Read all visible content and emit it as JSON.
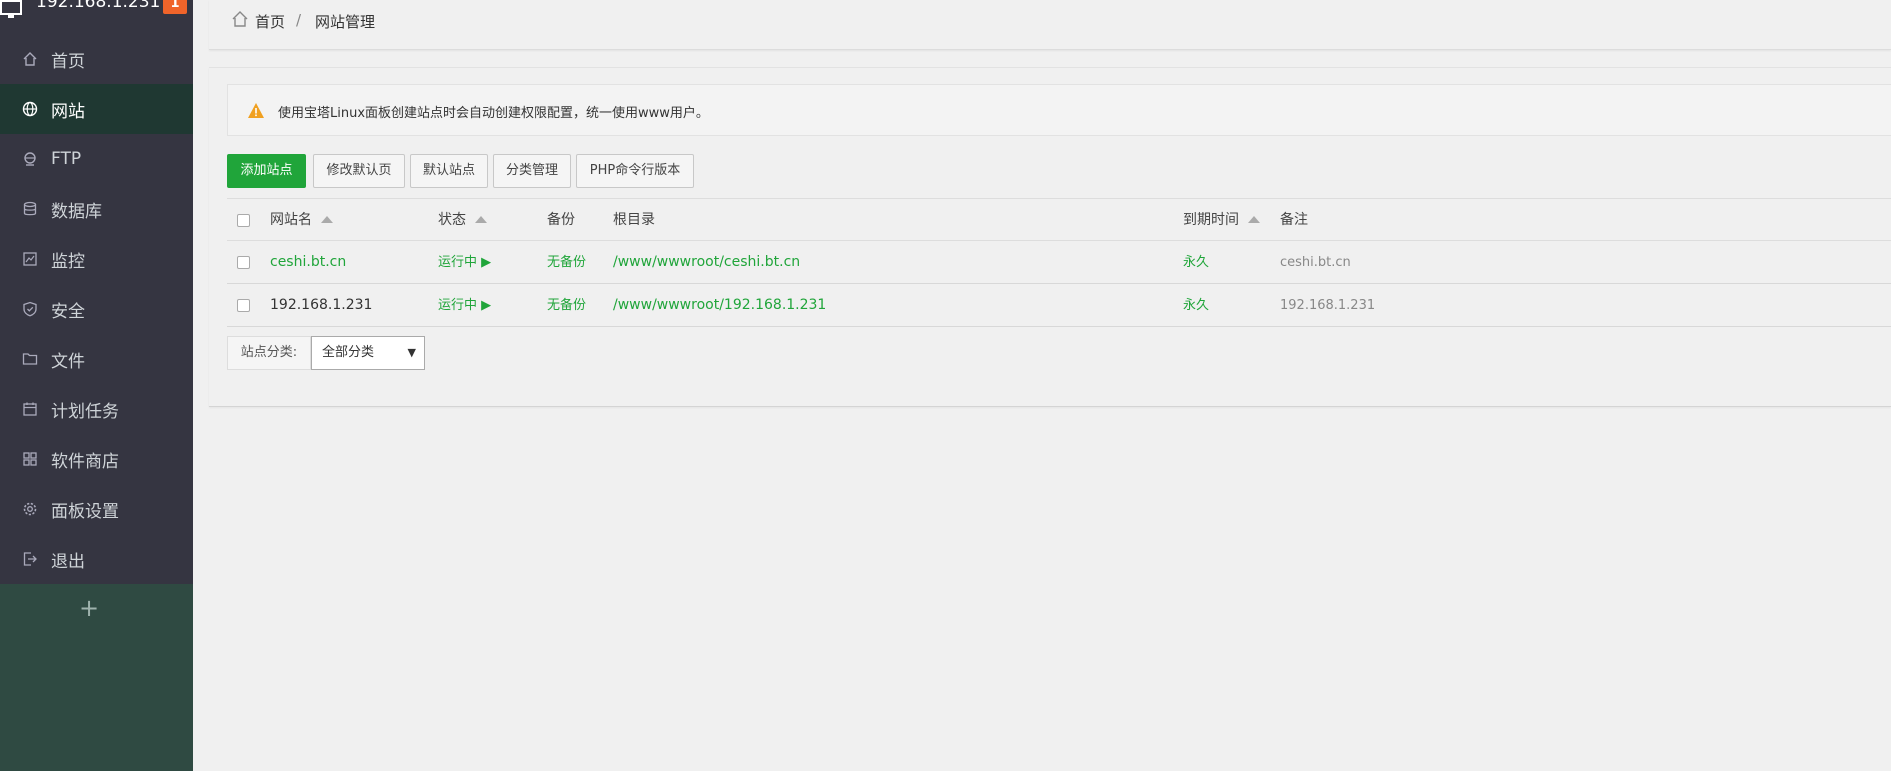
{
  "sidebar": {
    "ip": "192.168.1.231",
    "badge": "1",
    "items": [
      {
        "label": "首页",
        "icon": "home-icon"
      },
      {
        "label": "网站",
        "icon": "globe-icon",
        "active": true
      },
      {
        "label": "FTP",
        "icon": "ftp-icon"
      },
      {
        "label": "数据库",
        "icon": "database-icon"
      },
      {
        "label": "监控",
        "icon": "monitor-icon"
      },
      {
        "label": "安全",
        "icon": "shield-icon"
      },
      {
        "label": "文件",
        "icon": "folder-icon"
      },
      {
        "label": "计划任务",
        "icon": "calendar-icon"
      },
      {
        "label": "软件商店",
        "icon": "grid-icon"
      },
      {
        "label": "面板设置",
        "icon": "gear-icon"
      },
      {
        "label": "退出",
        "icon": "logout-icon"
      }
    ],
    "add": "+"
  },
  "breadcrumb": {
    "home": "首页",
    "sep": "/",
    "current": "网站管理"
  },
  "alert": {
    "text": "使用宝塔Linux面板创建站点时会自动创建权限配置，统一使用www用户。"
  },
  "toolbar": {
    "add_site": "添加站点",
    "edit_default_page": "修改默认页",
    "default_site": "默认站点",
    "category_manage": "分类管理",
    "php_cli": "PHP命令行版本"
  },
  "table": {
    "headers": {
      "name": "网站名",
      "status": "状态",
      "backup": "备份",
      "root": "根目录",
      "expire": "到期时间",
      "remark": "备注"
    },
    "rows": [
      {
        "name": "ceshi.bt.cn",
        "status": "运行中 ▶",
        "backup": "无备份",
        "root": "/www/wwwroot/ceshi.bt.cn",
        "expire": "永久",
        "remark": "ceshi.bt.cn"
      },
      {
        "name": "192.168.1.231",
        "status": "运行中 ▶",
        "backup": "无备份",
        "root": "/www/wwwroot/192.168.1.231",
        "expire": "永久",
        "remark": "192.168.1.231"
      }
    ]
  },
  "category": {
    "label": "站点分类:",
    "selected": "全部分类",
    "arrow": "▼"
  },
  "colors": {
    "accent": "#20a53a",
    "sidebar": "#353541",
    "badge": "#f0642a"
  }
}
